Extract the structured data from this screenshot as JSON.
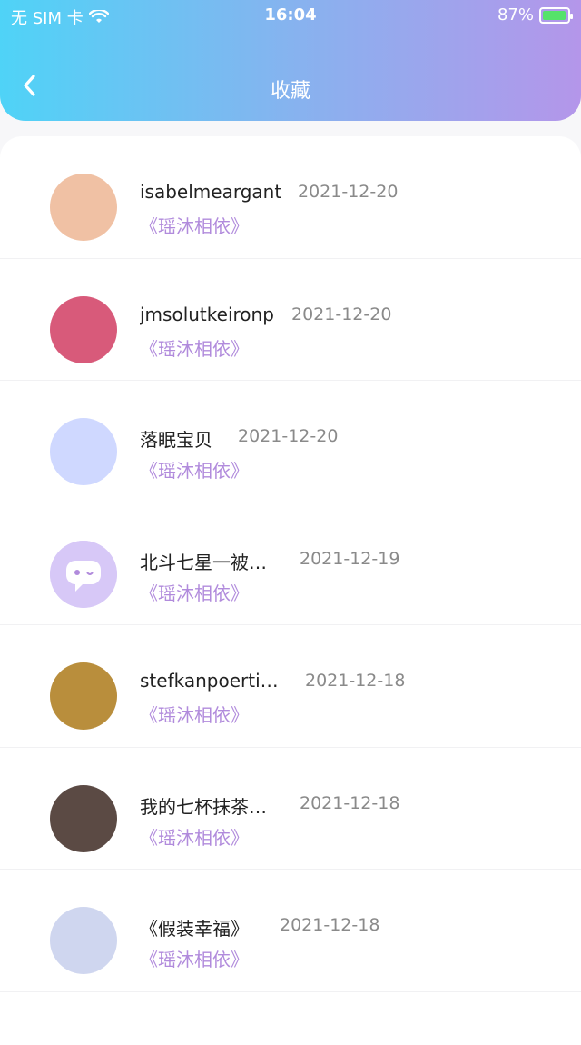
{
  "status": {
    "carrier": "无 SIM 卡",
    "time": "16:04",
    "battery": "87%"
  },
  "header": {
    "title": "收藏",
    "back_icon": "chevron-left-icon"
  },
  "favorites": [
    {
      "name": "isabelmeargant",
      "date": "2021-12-20",
      "work": "《瑶沐相依》",
      "avatar_color": "#f0c1a4"
    },
    {
      "name": "jmsolutkeironp",
      "date": "2021-12-20",
      "work": "《瑶沐相依》",
      "avatar_color": "#d85a7a"
    },
    {
      "name": "落眠宝贝",
      "date": "2021-12-20",
      "work": "《瑶沐相依》",
      "avatar_color": "#cfd8ff"
    },
    {
      "name": "北斗七星一被…",
      "date": "2021-12-19",
      "work": "《瑶沐相依》",
      "avatar_color": "#d7c8f7"
    },
    {
      "name": "stefkanpoerticci",
      "date": "2021-12-18",
      "work": "《瑶沐相依》",
      "avatar_color": "#b98e3c"
    },
    {
      "name": "我的七杯抹茶…",
      "date": "2021-12-18",
      "work": "《瑶沐相依》",
      "avatar_color": "#5b4a44"
    },
    {
      "name": "《假装幸福》",
      "date": "2021-12-18",
      "work": "《瑶沐相依》",
      "avatar_color": "#cfd6ef"
    }
  ],
  "colors": {
    "gradient_start": "#4fd3f7",
    "gradient_end": "#b496ea",
    "accent_text": "#b18bdc"
  }
}
